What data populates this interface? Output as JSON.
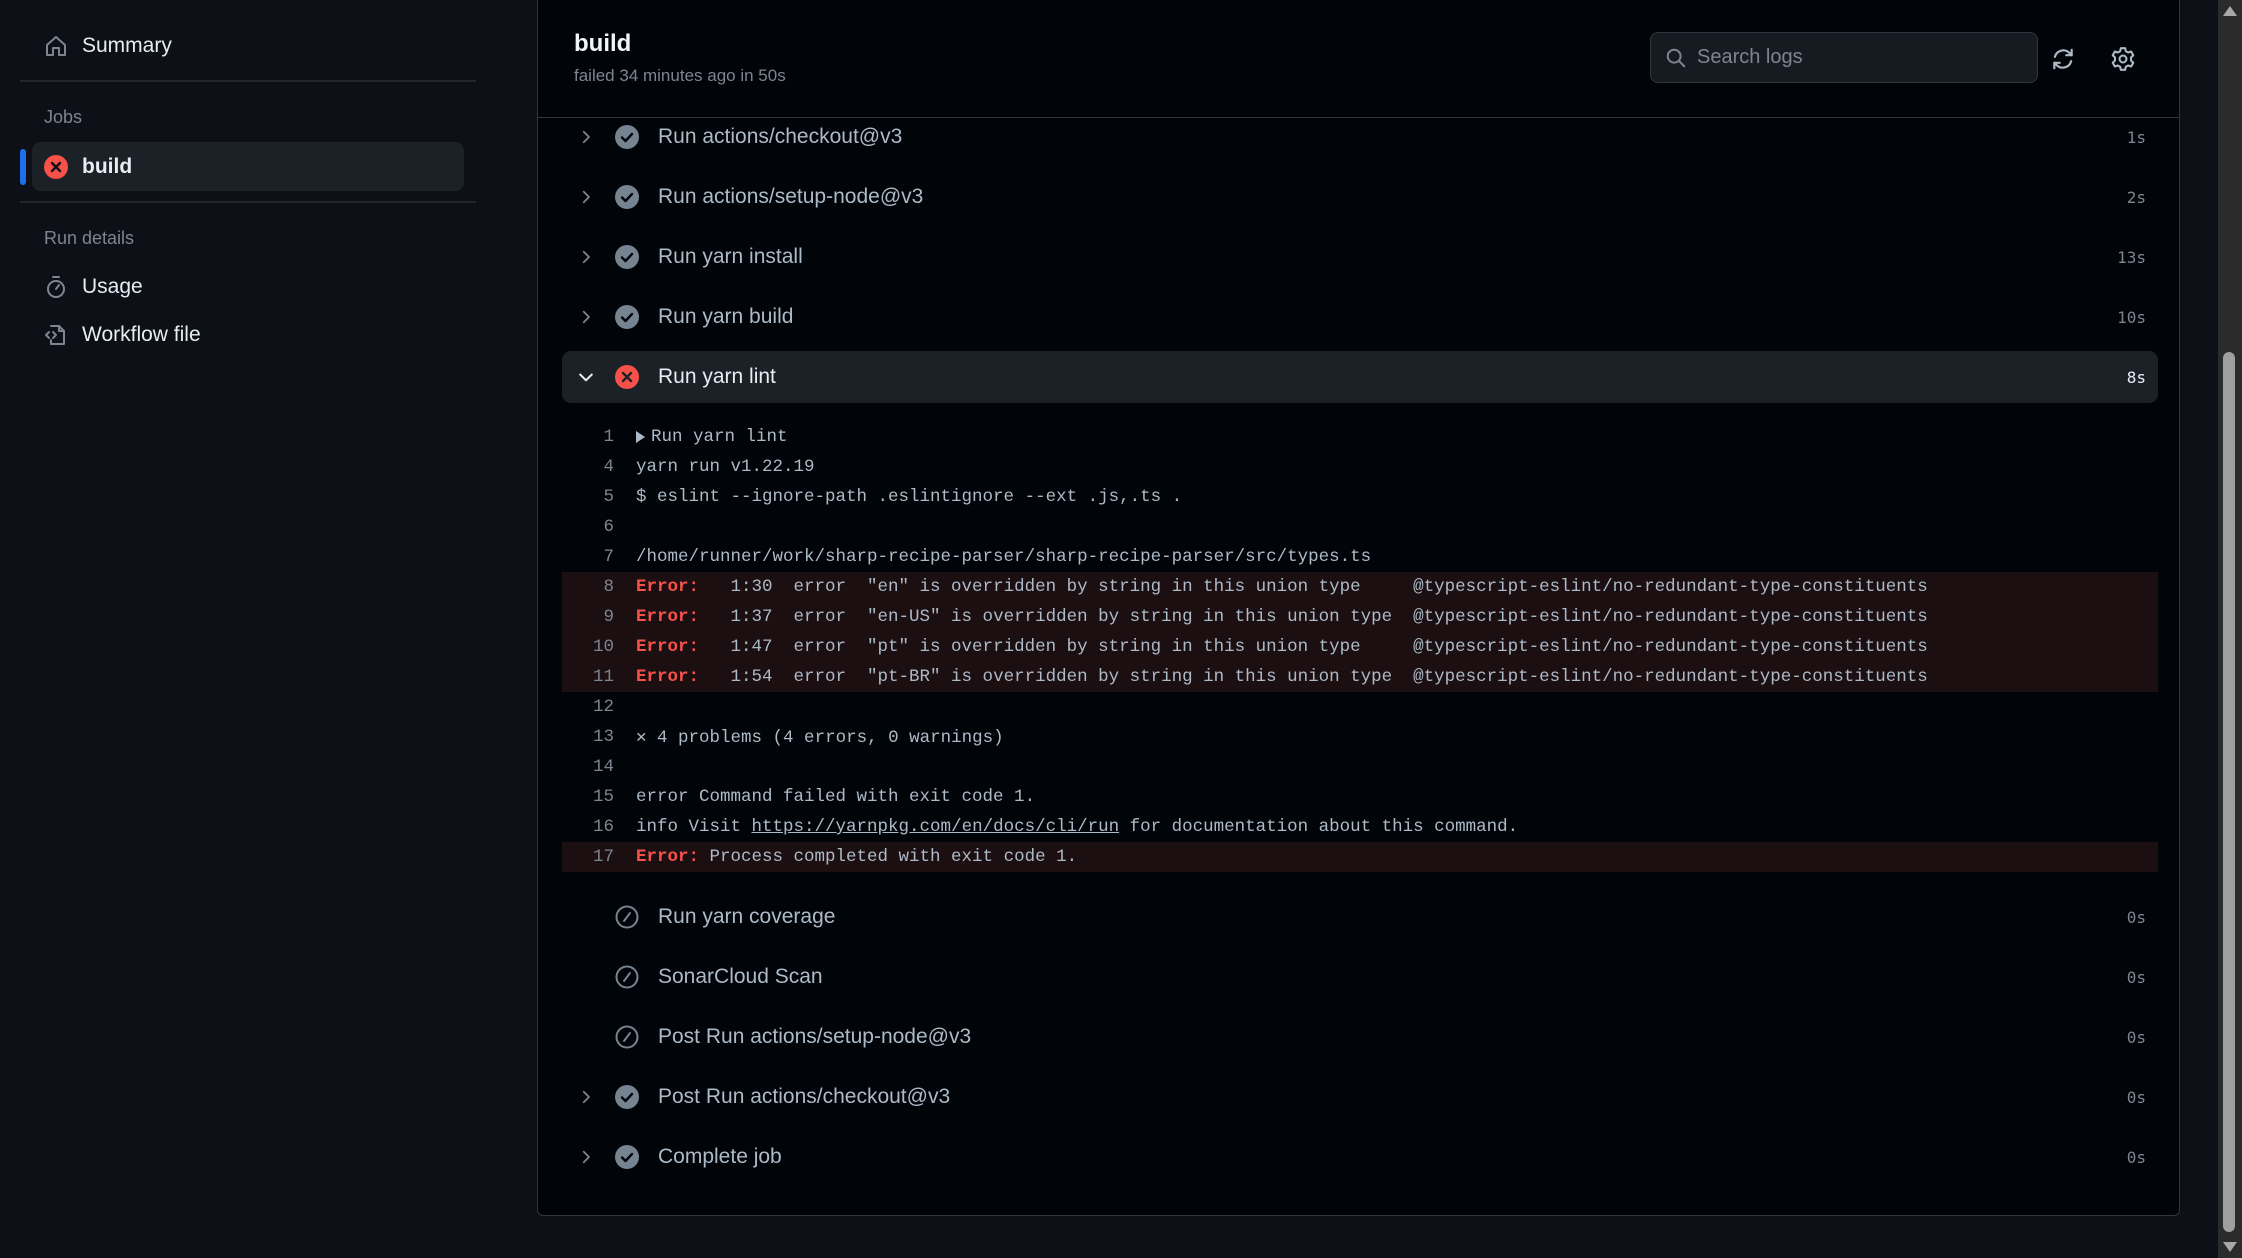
{
  "sidebar": {
    "summary_label": "Summary",
    "jobs_heading": "Jobs",
    "jobs": [
      {
        "label": "build",
        "status": "failure",
        "selected": true
      }
    ],
    "run_details_heading": "Run details",
    "run_details": [
      {
        "label": "Usage",
        "icon": "stopwatch-icon"
      },
      {
        "label": "Workflow file",
        "icon": "file-code-icon"
      }
    ]
  },
  "header": {
    "title": "build",
    "subtitle": "failed 34 minutes ago in 50s",
    "search_placeholder": "Search logs",
    "refresh_icon": "sync-icon",
    "settings_icon": "gear-icon"
  },
  "colors": {
    "failure": "#f85149",
    "success_icon": "#768390",
    "accent": "#1f6feb",
    "error_row_bg": "#1c0f12"
  },
  "steps": [
    {
      "name": "Run actions/checkout@v3",
      "duration": "1s",
      "status": "success",
      "expandable": true
    },
    {
      "name": "Run actions/setup-node@v3",
      "duration": "2s",
      "status": "success",
      "expandable": true
    },
    {
      "name": "Run yarn install",
      "duration": "13s",
      "status": "success",
      "expandable": true
    },
    {
      "name": "Run yarn build",
      "duration": "10s",
      "status": "success",
      "expandable": true
    },
    {
      "name": "Run yarn lint",
      "duration": "8s",
      "status": "failure",
      "expandable": true,
      "expanded": true
    },
    {
      "name": "Run yarn coverage",
      "duration": "0s",
      "status": "skipped",
      "expandable": false
    },
    {
      "name": "SonarCloud Scan",
      "duration": "0s",
      "status": "skipped",
      "expandable": false
    },
    {
      "name": "Post Run actions/setup-node@v3",
      "duration": "0s",
      "status": "skipped",
      "expandable": false
    },
    {
      "name": "Post Run actions/checkout@v3",
      "duration": "0s",
      "status": "success",
      "expandable": true
    },
    {
      "name": "Complete job",
      "duration": "0s",
      "status": "success",
      "expandable": true
    }
  ],
  "log": [
    {
      "n": "1",
      "text": "Run yarn lint",
      "group": true
    },
    {
      "n": "4",
      "text": "yarn run v1.22.19"
    },
    {
      "n": "5",
      "text": "$ eslint --ignore-path .eslintignore --ext .js,.ts ."
    },
    {
      "n": "6",
      "text": ""
    },
    {
      "n": "7",
      "text": "/home/runner/work/sharp-recipe-parser/sharp-recipe-parser/src/types.ts"
    },
    {
      "n": "8",
      "error": true,
      "label": "Error:",
      "text": "   1:30  error  \"en\" is overridden by string in this union type     @typescript-eslint/no-redundant-type-constituents"
    },
    {
      "n": "9",
      "error": true,
      "label": "Error:",
      "text": "   1:37  error  \"en-US\" is overridden by string in this union type  @typescript-eslint/no-redundant-type-constituents"
    },
    {
      "n": "10",
      "error": true,
      "label": "Error:",
      "text": "   1:47  error  \"pt\" is overridden by string in this union type     @typescript-eslint/no-redundant-type-constituents"
    },
    {
      "n": "11",
      "error": true,
      "label": "Error:",
      "text": "   1:54  error  \"pt-BR\" is overridden by string in this union type  @typescript-eslint/no-redundant-type-constituents"
    },
    {
      "n": "12",
      "text": ""
    },
    {
      "n": "13",
      "text": "✕ 4 problems (4 errors, 0 warnings)"
    },
    {
      "n": "14",
      "text": ""
    },
    {
      "n": "15",
      "text": "error Command failed with exit code 1."
    },
    {
      "n": "16",
      "text_before": "info Visit ",
      "link": "https://yarnpkg.com/en/docs/cli/run",
      "text_after": " for documentation about this command."
    },
    {
      "n": "17",
      "error": true,
      "label": "Error:",
      "text": " Process completed with exit code 1."
    }
  ]
}
